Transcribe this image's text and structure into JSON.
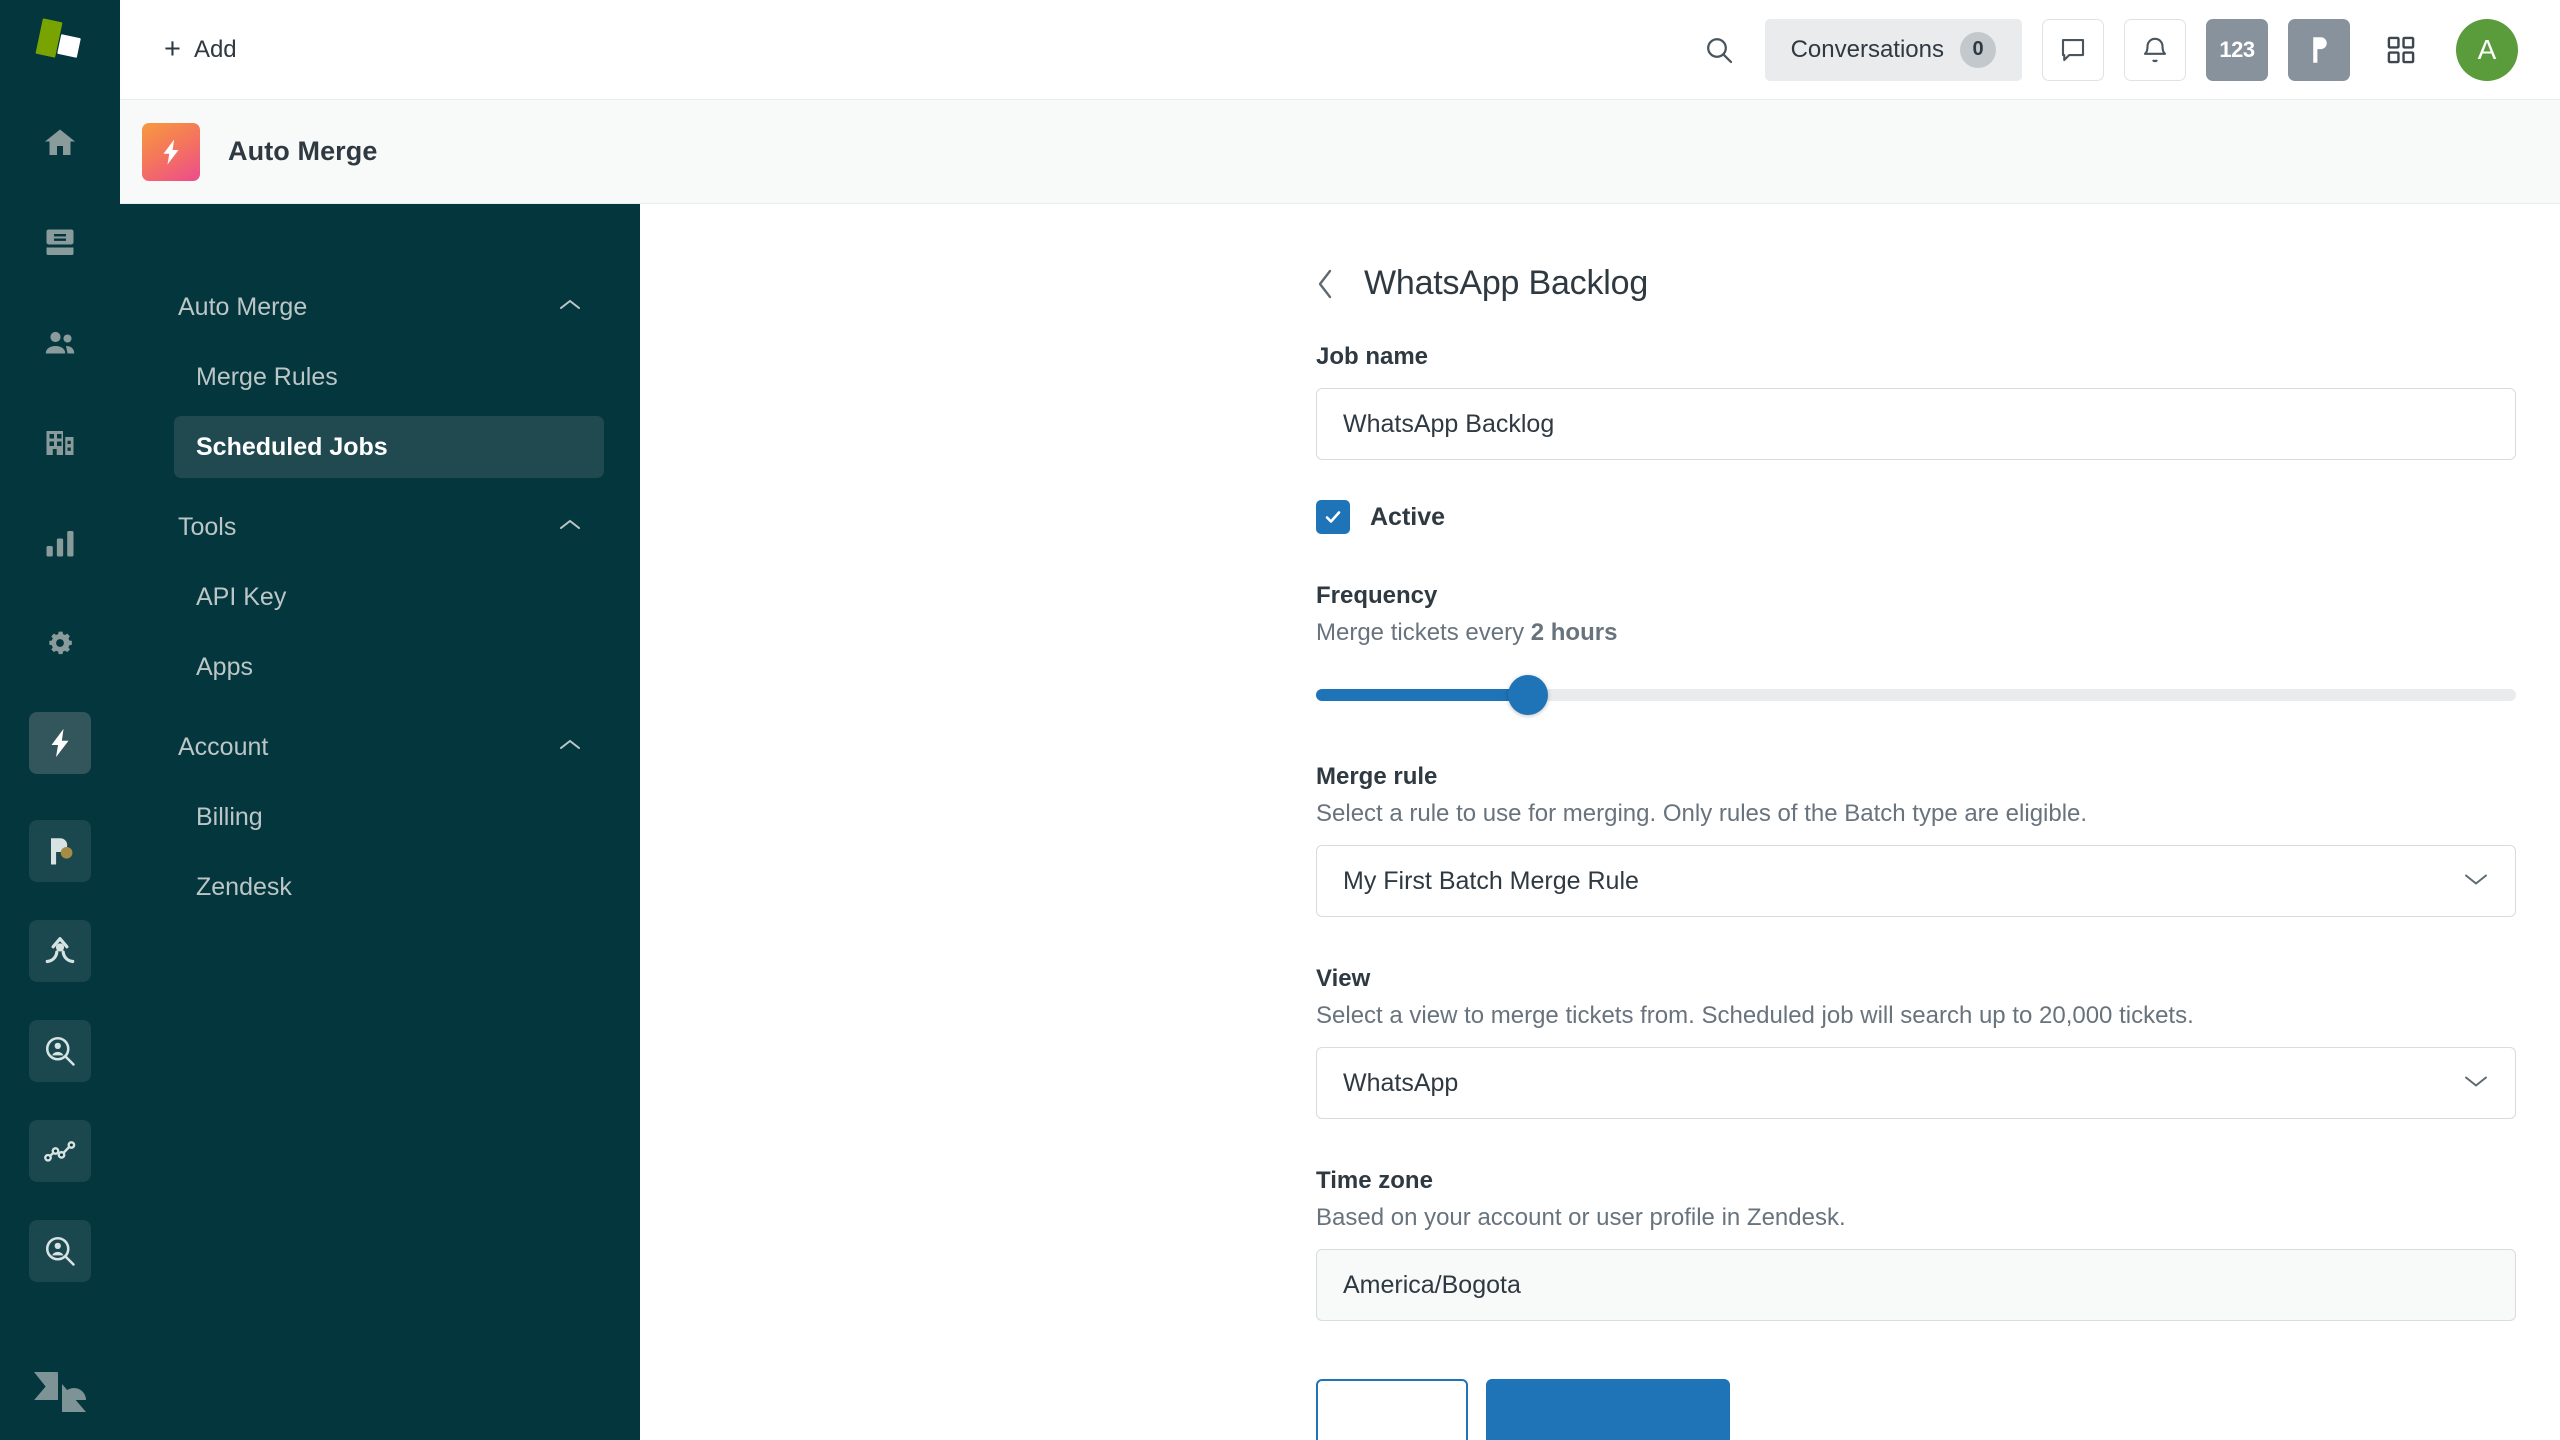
{
  "rail": {
    "logo_name": "zendesk-logo",
    "items": [
      {
        "name": "home-icon"
      },
      {
        "name": "views-icon"
      },
      {
        "name": "customers-icon"
      },
      {
        "name": "organizations-icon"
      },
      {
        "name": "reporting-icon"
      },
      {
        "name": "admin-gear-icon"
      },
      {
        "name": "auto-merge-app-icon",
        "active": true
      }
    ],
    "apps": [
      {
        "name": "proactive-campaigns-app-icon"
      },
      {
        "name": "merge-app-icon"
      },
      {
        "name": "user-lookup-app-icon"
      },
      {
        "name": "analytics-app-icon"
      },
      {
        "name": "user-search-app-icon"
      }
    ],
    "bottom": {
      "name": "zendesk-mark-icon"
    }
  },
  "topbar": {
    "add_label": "Add",
    "add_icon": "plus-icon",
    "search_icon": "search-icon",
    "conversations": {
      "label": "Conversations",
      "count": "0"
    },
    "chat_icon": "chat-bubble-icon",
    "bell_icon": "notification-bell-icon",
    "numbers_label": "123",
    "p_app_label": "P",
    "grid_icon": "apps-grid-icon",
    "avatar_initial": "A"
  },
  "app_header": {
    "icon": "lightning-bolt-icon",
    "title": "Auto Merge"
  },
  "nav": {
    "groups": [
      {
        "label": "Auto Merge",
        "chevron": "chevron-up-icon",
        "items": [
          {
            "label": "Merge Rules",
            "active": false
          },
          {
            "label": "Scheduled Jobs",
            "active": true
          }
        ]
      },
      {
        "label": "Tools",
        "chevron": "chevron-up-icon",
        "items": [
          {
            "label": "API Key",
            "active": false
          },
          {
            "label": "Apps",
            "active": false
          }
        ]
      },
      {
        "label": "Account",
        "chevron": "chevron-up-icon",
        "items": [
          {
            "label": "Billing",
            "active": false
          },
          {
            "label": "Zendesk",
            "active": false
          }
        ]
      }
    ]
  },
  "page": {
    "back_icon": "chevron-left-icon",
    "title": "WhatsApp Backlog",
    "job_name": {
      "label": "Job name",
      "value": "WhatsApp Backlog"
    },
    "active": {
      "label": "Active",
      "checked": true,
      "check_icon": "checkmark-icon"
    },
    "frequency": {
      "label": "Frequency",
      "desc_prefix": "Merge tickets every ",
      "desc_value": "2 hours",
      "slider_percent": 17.7
    },
    "merge_rule": {
      "label": "Merge rule",
      "desc": "Select a rule to use for merging. Only rules of the Batch type are eligible.",
      "value": "My First Batch Merge Rule",
      "chevron": "chevron-down-icon"
    },
    "view": {
      "label": "View",
      "desc": "Select a view to merge tickets from. Scheduled job will search up to 20,000 tickets.",
      "value": "WhatsApp",
      "chevron": "chevron-down-icon"
    },
    "timezone": {
      "label": "Time zone",
      "desc": "Based on your account or user profile in Zendesk.",
      "value": "America/Bogota"
    },
    "buttons": {
      "cancel_label": "",
      "save_label": ""
    }
  },
  "colors": {
    "rail_bg": "#03363D",
    "accent_blue": "#1F73B7",
    "avatar_green": "#5A9B3C",
    "app_icon_gradient_start": "#F79A3E",
    "app_icon_gradient_end": "#ED4B8D"
  }
}
